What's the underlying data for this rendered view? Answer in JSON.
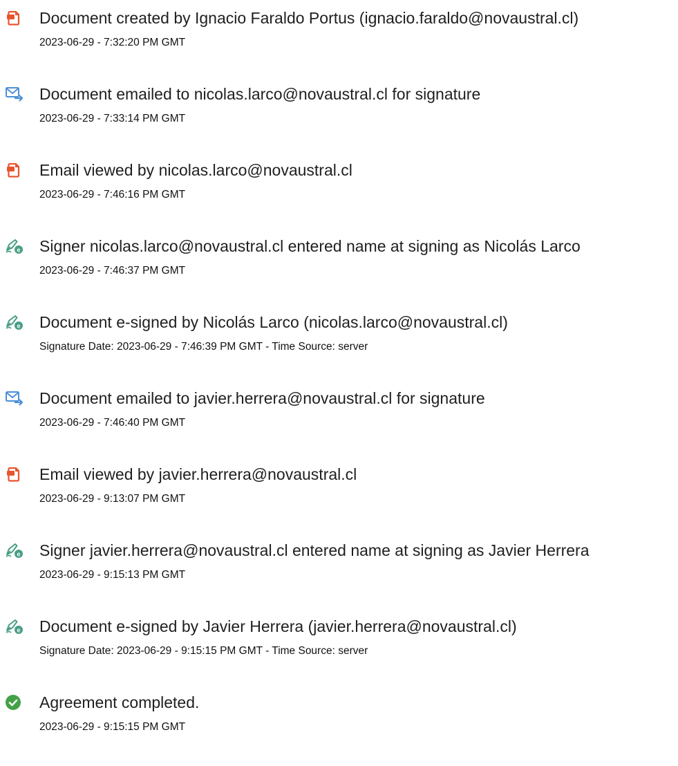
{
  "colors": {
    "doc_icon": "#e8552d",
    "mail_icon": "#4a8fd6",
    "sign_icon": "#4a9e86",
    "check_icon": "#43a047"
  },
  "events": [
    {
      "icon": "document-icon",
      "title": "Document created by Ignacio Faraldo Portus (ignacio.faraldo@novaustral.cl)",
      "meta": "2023-06-29 - 7:32:20 PM GMT"
    },
    {
      "icon": "email-sent-icon",
      "title": "Document emailed to nicolas.larco@novaustral.cl for signature",
      "meta": "2023-06-29 - 7:33:14 PM GMT"
    },
    {
      "icon": "document-icon",
      "title": "Email viewed by nicolas.larco@novaustral.cl",
      "meta": "2023-06-29 - 7:46:16 PM GMT"
    },
    {
      "icon": "esign-pen-icon",
      "title": "Signer nicolas.larco@novaustral.cl entered name at signing as Nicolás Larco",
      "meta": "2023-06-29 - 7:46:37 PM GMT"
    },
    {
      "icon": "esign-pen-icon",
      "title": "Document e-signed by Nicolás Larco (nicolas.larco@novaustral.cl)",
      "meta": "Signature Date: 2023-06-29 - 7:46:39 PM GMT - Time Source: server"
    },
    {
      "icon": "email-sent-icon",
      "title": "Document emailed to javier.herrera@novaustral.cl for signature",
      "meta": "2023-06-29 - 7:46:40 PM GMT"
    },
    {
      "icon": "document-icon",
      "title": "Email viewed by javier.herrera@novaustral.cl",
      "meta": "2023-06-29 - 9:13:07 PM GMT"
    },
    {
      "icon": "esign-pen-icon",
      "title": "Signer javier.herrera@novaustral.cl entered name at signing as Javier Herrera",
      "meta": "2023-06-29 - 9:15:13 PM GMT"
    },
    {
      "icon": "esign-pen-icon",
      "title": "Document e-signed by Javier Herrera (javier.herrera@novaustral.cl)",
      "meta": "Signature Date: 2023-06-29 - 9:15:15 PM GMT - Time Source: server"
    },
    {
      "icon": "check-circle-icon",
      "title": "Agreement completed.",
      "meta": "2023-06-29 - 9:15:15 PM GMT"
    }
  ]
}
